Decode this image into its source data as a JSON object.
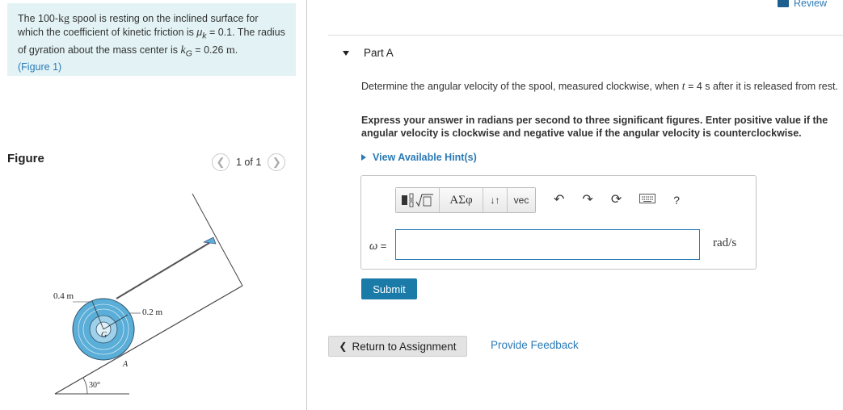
{
  "problem": {
    "text_1": "The 100-",
    "unit_kg": "kg",
    "text_2": " spool is resting on the inclined surface for which the coefficient of kinetic friction is ",
    "mu_symbol": "μ",
    "mu_sub": "k",
    "text_3": " = 0.1. The radius of gyration about the mass center is ",
    "k_symbol": "k",
    "k_sub": "G",
    "text_4": " = 0.26 ",
    "unit_m": "m",
    "text_5": ".",
    "figure_link": "(Figure 1)"
  },
  "figure_panel": {
    "label": "Figure",
    "pager_text": "1 of 1",
    "prev_icon": "chevron-left-icon",
    "next_icon": "chevron-right-icon",
    "labels": {
      "outer_radius": "0.4 m",
      "inner_radius": "0.2 m",
      "center": "G",
      "contact": "A",
      "angle": "30°"
    }
  },
  "header": {
    "review_label": "Review",
    "review_icon": "book-icon"
  },
  "part": {
    "title": "Part A",
    "question_pre": "Determine the angular velocity of the spool, measured clockwise, when ",
    "question_var": "t",
    "question_post": " = 4 s after it is released from rest.",
    "instruction": "Express your answer in radians per second to three significant figures. Enter positive value if the angular velocity is clockwise and negative value if the angular velocity is counterclockwise.",
    "hints_label": "View Available Hint(s)"
  },
  "toolbar": {
    "templates_icon": "templates-radical-icon",
    "greek_label": "ΑΣφ",
    "arrows_label": "↓↑",
    "vec_label": "vec",
    "undo_icon": "undo-icon",
    "redo_icon": "redo-icon",
    "reset_icon": "reset-icon",
    "keyboard_icon": "keyboard-icon",
    "help_label": "?"
  },
  "answer": {
    "variable": "ω",
    "equals": " =",
    "value": "",
    "unit": "rad/s"
  },
  "actions": {
    "submit_label": "Submit",
    "return_label": "Return to Assignment",
    "feedback_label": "Provide Feedback"
  },
  "colors": {
    "accent": "#2a7ab6",
    "submit_bg": "#1a7aa8",
    "problem_bg": "#e3f3f5",
    "spool_blue": "#5aaed8"
  }
}
